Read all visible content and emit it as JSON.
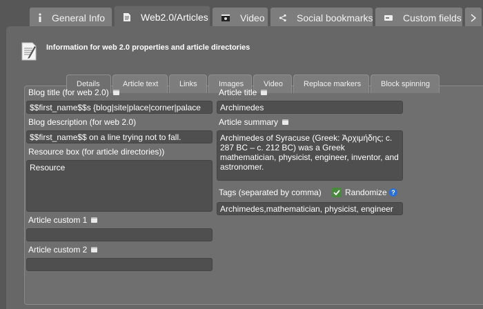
{
  "top_tabs": [
    {
      "label": "General Info",
      "icon": "info-icon"
    },
    {
      "label": "Web2.0/Articles",
      "icon": "document-icon",
      "active": true
    },
    {
      "label": "Video",
      "icon": "film-icon"
    },
    {
      "label": "Social bookmarks",
      "icon": "share-icon"
    },
    {
      "label": "Custom fields",
      "icon": "card-icon"
    }
  ],
  "header": {
    "title": "Information for web 2.0 properties and article directories"
  },
  "inner_tabs": [
    {
      "label": "Details",
      "active": true
    },
    {
      "label": "Article text"
    },
    {
      "label": "Links"
    },
    {
      "label": "Images"
    },
    {
      "label": "Video"
    },
    {
      "label": "Replace markers"
    },
    {
      "label": "Block spinning"
    }
  ],
  "form": {
    "blog_title_label": "Blog title (for web 2.0)",
    "blog_title_value": "$$first_name$$s {blog|site|place|corner|palace",
    "blog_description_label": "Blog description (for web 2.0)",
    "blog_description_value": "$$first_name$$ on a line trying not to fall.",
    "resource_box_label": "Resource box (for article directories))",
    "resource_box_value": "Resource",
    "article_custom_1_label": "Article custom 1",
    "article_custom_1_value": "",
    "article_custom_2_label": "Article custom 2",
    "article_custom_2_value": "",
    "article_title_label": "Article title",
    "article_title_value": "Archimedes",
    "article_summary_label": "Article summary",
    "article_summary_value": "Archimedes of Syracuse (Greek: Ἀρχιμήδης; c. 287 BC – c. 212 BC) was a Greek mathematician, physicist, engineer, inventor, and astronomer.",
    "tags_label": "Tags (separated by comma)",
    "randomize_label": "Randomize",
    "randomize_checked": true,
    "help_glyph": "?",
    "tags_value": "Archimedes,mathematician, physicist, engineer"
  },
  "colors": {
    "accent_check": "#4a8a3d",
    "help_blue": "#2a6fd6"
  }
}
